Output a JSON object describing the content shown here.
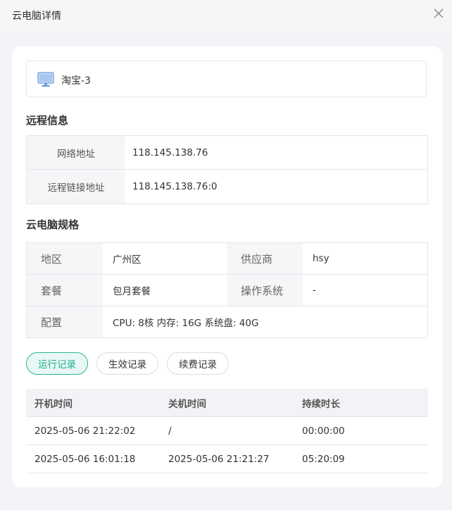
{
  "dialog": {
    "title": "云电脑详情",
    "close_icon": "close-icon"
  },
  "device": {
    "icon": "monitor-icon",
    "name": "淘宝-3"
  },
  "remote": {
    "title": "远程信息",
    "rows": [
      {
        "label": "网络地址",
        "value": "118.145.138.76"
      },
      {
        "label": "远程链接地址",
        "value": "118.145.138.76:0"
      }
    ]
  },
  "spec": {
    "title": "云电脑规格",
    "region_label": "地区",
    "region_value": "广州区",
    "vendor_label": "供应商",
    "vendor_value": "hsy",
    "plan_label": "套餐",
    "plan_value": "包月套餐",
    "os_label": "操作系统",
    "os_value": "-",
    "config_label": "配置",
    "config_value": "CPU: 8核 内存: 16G 系统盘: 40G"
  },
  "tabs": [
    {
      "label": "运行记录",
      "active": true
    },
    {
      "label": "生效记录",
      "active": false
    },
    {
      "label": "续费记录",
      "active": false
    }
  ],
  "records": {
    "columns": [
      "开机时间",
      "关机时间",
      "持续时长"
    ],
    "rows": [
      [
        "2025-05-06 21:22:02",
        "/",
        "00:00:00"
      ],
      [
        "2025-05-06 16:01:18",
        "2025-05-06 21:21:27",
        "05:20:09"
      ]
    ]
  },
  "colors": {
    "accent": "#27b59b",
    "accent_text": "#1fae93",
    "accent_bg": "#e9f8f4",
    "label_bg": "#f5f6f8",
    "page_bg": "#f2f4f7"
  }
}
